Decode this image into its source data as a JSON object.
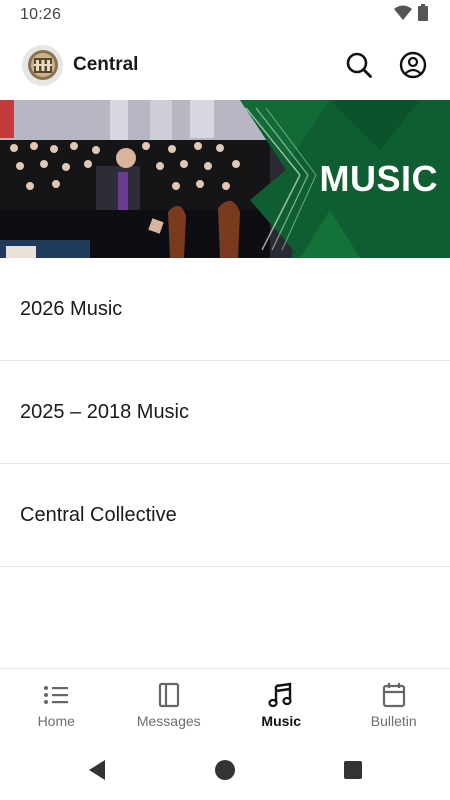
{
  "status_bar": {
    "time": "10:26"
  },
  "header": {
    "title": "Central",
    "icons": [
      "search-icon",
      "account-circle-icon"
    ]
  },
  "banner": {
    "title": "MUSIC"
  },
  "list": {
    "items": [
      {
        "label": "2026 Music"
      },
      {
        "label": "2025 – 2018 Music"
      },
      {
        "label": "Central Collective"
      }
    ]
  },
  "bottom_nav": {
    "items": [
      {
        "label": "Home",
        "icon": "list-icon"
      },
      {
        "label": "Messages",
        "icon": "book-icon"
      },
      {
        "label": "Music",
        "icon": "music-note-icon"
      },
      {
        "label": "Bulletin",
        "icon": "calendar-icon"
      }
    ],
    "active": "Music"
  },
  "colors": {
    "banner_green": "#0f5e31",
    "active_text": "#111111",
    "inactive_text": "#6e6e6e"
  }
}
